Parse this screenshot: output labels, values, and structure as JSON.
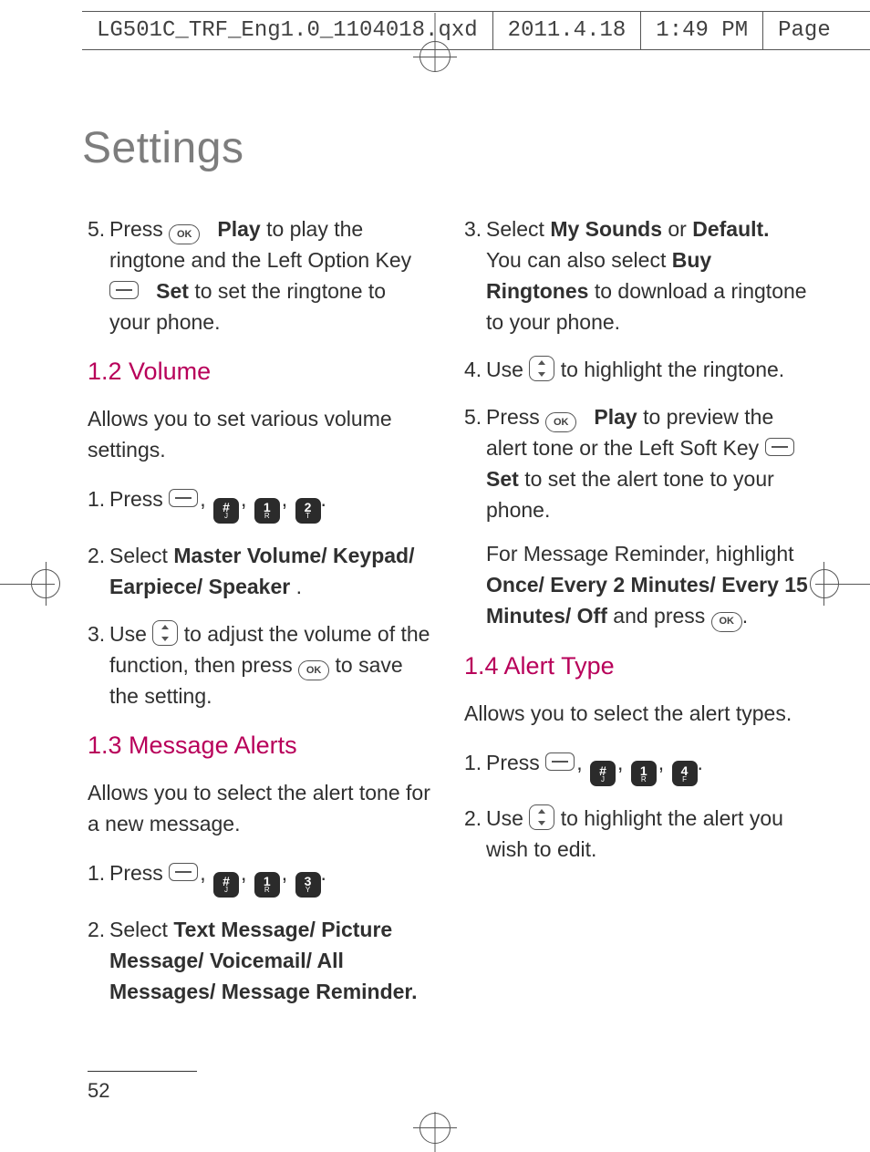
{
  "header": {
    "filename": "LG501C_TRF_Eng1.0_1104018.qxd",
    "date": "2011.4.18",
    "time": "1:49 PM",
    "page_label": "Page"
  },
  "title": "Settings",
  "page_number": "52",
  "keys": {
    "ok": "OK",
    "hash": {
      "main": "#",
      "sub": "J"
    },
    "one": {
      "main": "1",
      "sub": "R"
    },
    "two": {
      "main": "2",
      "sub": "T"
    },
    "three": {
      "main": "3",
      "sub": "Y"
    },
    "four": {
      "main": "4",
      "sub": "F"
    }
  },
  "left": {
    "step5": {
      "num": "5.",
      "a": "Press ",
      "play": "Play",
      "b": " to play the ringtone and the Left Option Key ",
      "set": "Set",
      "c": " to set the ringtone to your phone."
    },
    "sec12": {
      "head": "1.2 Volume",
      "intro": "Allows you to set various volume settings.",
      "s1": {
        "num": "1.",
        "a": "Press "
      },
      "s2": {
        "num": "2.",
        "a": "Select ",
        "b": "Master Volume/ Keypad/ Earpiece/ Speaker",
        "c": "."
      },
      "s3": {
        "num": "3.",
        "a": "Use ",
        "b": " to adjust the volume of the function, then press ",
        "c": " to save the setting."
      }
    },
    "sec13": {
      "head": "1.3 Message Alerts",
      "intro": "Allows you to select the alert tone for a new message.",
      "s1": {
        "num": "1.",
        "a": "Press "
      },
      "s2": {
        "num": "2.",
        "a": "Select ",
        "b": "Text Message/ Picture Message/ Voicemail/ All Messages/ Message Reminder.",
        "c": ""
      }
    }
  },
  "right": {
    "s3": {
      "num": "3.",
      "a": "Select ",
      "b": "My Sounds",
      "c": " or ",
      "d": "Default.",
      "e": " You can also select ",
      "f": "Buy Ringtones",
      "g": " to download a ringtone to your phone."
    },
    "s4": {
      "num": "4.",
      "a": "Use ",
      "b": " to highlight the ringtone."
    },
    "s5": {
      "num": "5.",
      "a": "Press ",
      "play": "Play",
      "b": " to preview the alert tone or the Left Soft Key ",
      "set": "Set",
      "c": " to set the alert tone to your phone."
    },
    "s5b": {
      "a": "For Message Reminder, highlight ",
      "b": "Once/ Every 2 Minutes/ Every 15 Minutes/ Off",
      "c": " and press "
    },
    "sec14": {
      "head": "1.4 Alert Type",
      "intro": "Allows you to select the alert types.",
      "s1": {
        "num": "1.",
        "a": "Press "
      },
      "s2": {
        "num": "2.",
        "a": "Use ",
        "b": " to highlight the alert you wish to edit."
      }
    }
  }
}
